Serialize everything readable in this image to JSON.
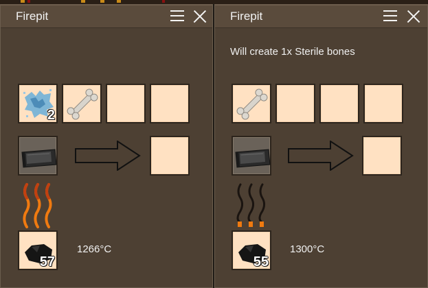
{
  "windows": [
    {
      "title": "Firepit",
      "info_text": "",
      "input_slots": [
        {
          "item": "blue-crystal-icon",
          "quantity": "2"
        },
        {
          "item": "bone-icon",
          "quantity": ""
        },
        {
          "item": "empty",
          "quantity": ""
        },
        {
          "item": "empty",
          "quantity": ""
        }
      ],
      "tool_slot": {
        "item": "cooking-pot-icon"
      },
      "output_slot": {
        "item": "empty"
      },
      "fire_state": "burning",
      "fuel": {
        "item": "coal-icon",
        "quantity": "57"
      },
      "temperature": "1266°C"
    },
    {
      "title": "Firepit",
      "info_text": "Will create 1x Sterile bones",
      "input_slots": [
        {
          "item": "bone-icon",
          "quantity": ""
        },
        {
          "item": "empty",
          "quantity": ""
        },
        {
          "item": "empty",
          "quantity": ""
        },
        {
          "item": "empty",
          "quantity": ""
        }
      ],
      "tool_slot": {
        "item": "cooking-pot-icon"
      },
      "output_slot": {
        "item": "empty"
      },
      "fire_state": "smoldering",
      "fuel": {
        "item": "coal-icon",
        "quantity": "55"
      },
      "temperature": "1300°C"
    }
  ],
  "colors": {
    "panel_bg": "#4d4033",
    "titlebar_bg": "#5a4b3c",
    "slot_bg": "#ffe1c2",
    "slot_border": "#2c241c",
    "flame_orange": "#f07a10",
    "smoke_dark": "#1a1410"
  }
}
